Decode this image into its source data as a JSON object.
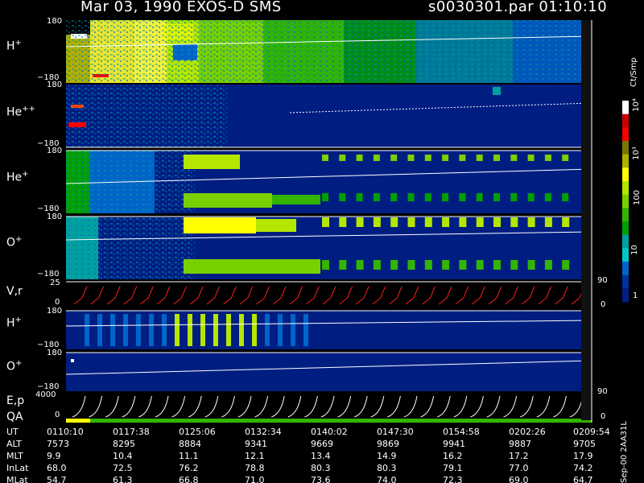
{
  "header": {
    "date_mission": "Mar 03, 1990   EXOS-D SMS",
    "file_time": "s0030301.par  01:10:10"
  },
  "panels": [
    {
      "label": "H",
      "sup": "+",
      "top": "180",
      "bottom": "−180"
    },
    {
      "label": "He",
      "sup": "++",
      "top": "180",
      "bottom": "−180"
    },
    {
      "label": "He",
      "sup": "+",
      "top": "180",
      "bottom": "−180"
    },
    {
      "label": "O",
      "sup": "+",
      "top": "180",
      "bottom": "−180"
    },
    {
      "label": "V,r",
      "sup": "",
      "top": "25",
      "bottom": "0"
    },
    {
      "label": "H",
      "sup": "+",
      "top": "180",
      "bottom": "−180"
    },
    {
      "label": "O",
      "sup": "+",
      "top": "180",
      "bottom": "−180"
    },
    {
      "label": "E,p",
      "sup": "",
      "top": "4000",
      "bottom": "0"
    }
  ],
  "qa_label": "QA",
  "right_ticks": {
    "vr_top": "90",
    "vr_bottom": "0",
    "ep_top": "90",
    "ep_bottom": "0"
  },
  "colorbar": {
    "unit": "Ct/Smp",
    "labels": [
      "10⁴",
      "10³",
      "100",
      "10",
      "1"
    ],
    "colors": [
      "#ffffff",
      "#c80000",
      "#ff0000",
      "#787800",
      "#b0b000",
      "#ffff00",
      "#b4e600",
      "#78d000",
      "#32b400",
      "#00a000",
      "#00a0a0",
      "#00c8c8",
      "#0064c8",
      "#0032a0",
      "#001e82"
    ]
  },
  "chart_data": {
    "type": "heatmap",
    "title": "Mar 03, 1990   EXOS-D SMS",
    "subtitle": "s0030301.par  01:10:10",
    "xlabel": "UT",
    "x_ticks": [
      "0110:10",
      "0117:38",
      "0125:06",
      "0132:34",
      "0140:02",
      "0147:30",
      "0154:58",
      "0202:26",
      "0209:54"
    ],
    "colorbar_unit": "Ct/Smp",
    "table": {
      "rows": [
        {
          "name": "UT",
          "values": [
            "0110:10",
            "0117:38",
            "0125:06",
            "0132:34",
            "0140:02",
            "0147:30",
            "0154:58",
            "0202:26",
            "0209:54"
          ]
        },
        {
          "name": "ALT",
          "values": [
            "7573",
            "8295",
            "8884",
            "9341",
            "9669",
            "9869",
            "9941",
            "9887",
            "9705"
          ]
        },
        {
          "name": "MLT",
          "values": [
            "9.9",
            "10.4",
            "11.1",
            "12.1",
            "13.4",
            "14.9",
            "16.2",
            "17.2",
            "17.9"
          ]
        },
        {
          "name": "InLat",
          "values": [
            "68.0",
            "72.5",
            "76.2",
            "78.8",
            "80.3",
            "80.3",
            "79.1",
            "77.0",
            "74.2"
          ]
        },
        {
          "name": "MLat",
          "values": [
            "54.7",
            "61.3",
            "66.8",
            "71.0",
            "73.6",
            "74.0",
            "72.3",
            "69.0",
            "64.7"
          ]
        }
      ]
    }
  },
  "footer": {
    "sideways": "Sep-00  2AA31L"
  }
}
